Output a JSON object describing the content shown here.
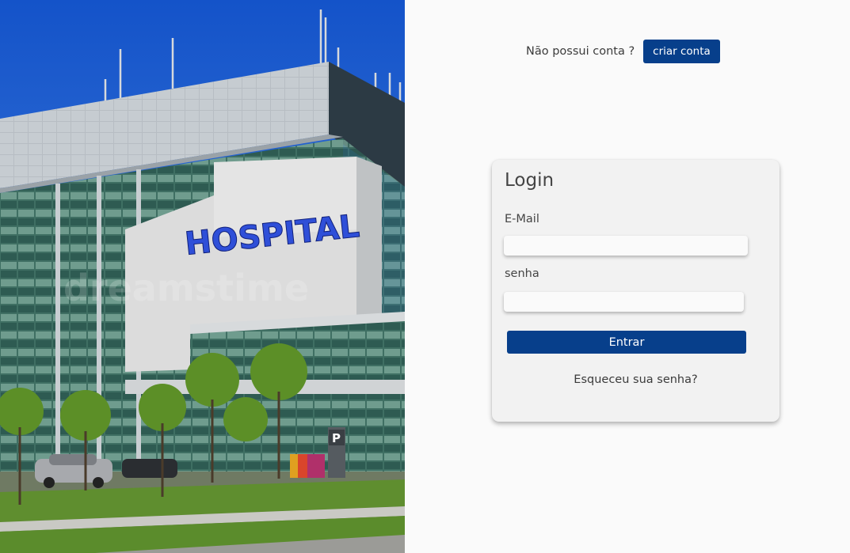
{
  "hero": {
    "sign_text": "HOSPITAL",
    "parking_sign": "P",
    "watermark": "dreamstime"
  },
  "signup": {
    "prompt": "Não possui conta ?",
    "button_label": "criar conta"
  },
  "login": {
    "title": "Login",
    "email_label": "E-Mail",
    "email_value": "",
    "password_label": "senha",
    "password_value": "",
    "submit_label": "Entrar",
    "forgot_label": "Esqueceu sua senha?"
  },
  "colors": {
    "primary": "#073f8b",
    "background": "#fafafa",
    "card": "#f2f2f2",
    "sign_blue": "#2f4fd8",
    "sky": "#1e5fd0"
  }
}
